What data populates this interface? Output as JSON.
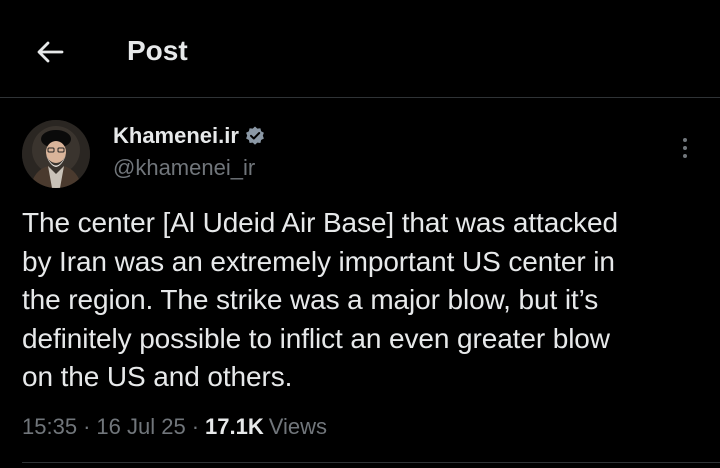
{
  "header": {
    "title": "Post"
  },
  "author": {
    "display_name": "Khamenei.ir",
    "handle": "@khamenei_ir",
    "verified": true
  },
  "post": {
    "text": "The center [Al Udeid Air Base] that was attacked\nby Iran was an extremely important US center in\nthe region. The strike was a major blow, but it’s\ndefinitely possible to inflict an even greater blow\non the US and others.",
    "time": "15:35",
    "separator": "·",
    "date": "16 Jul 25",
    "views_count": "17.1K",
    "views_label": "Views"
  },
  "icons": {
    "back": "arrow-left-icon",
    "verified": "verified-badge-icon",
    "more": "more-vertical-icon"
  },
  "colors": {
    "background": "#000000",
    "primary_text": "#e7e9ea",
    "secondary_text": "#71767b",
    "divider": "#2f3336",
    "verified_badge": "#8b98a5"
  }
}
